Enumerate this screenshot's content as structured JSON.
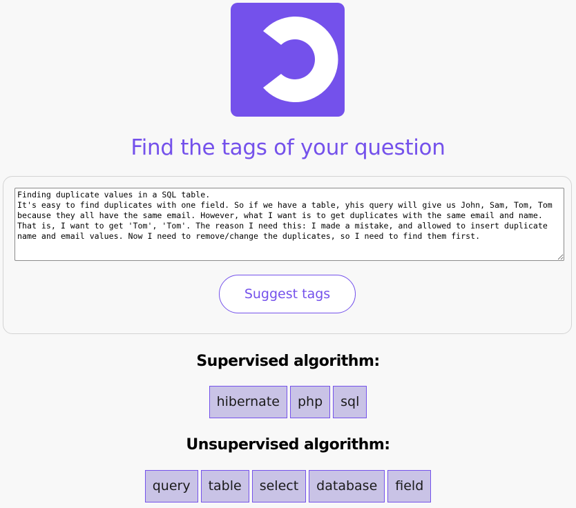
{
  "app": {
    "title": "Find the tags of your question",
    "brand_color": "#7451eb",
    "logo_icon": "half-ring-logo-icon"
  },
  "form": {
    "question_text": "Finding duplicate values in a SQL table.\nIt's easy to find duplicates with one field. So if we have a table, yhis query will give us John, Sam, Tom, Tom because they all have the same email. However, what I want is to get duplicates with the same email and name. That is, I want to get 'Tom', 'Tom'. The reason I need this: I made a mistake, and allowed to insert duplicate name and email values. Now I need to remove/change the duplicates, so I need to find them first.",
    "submit_label": "Suggest tags"
  },
  "results": {
    "supervised": {
      "heading": "Supervised algorithm:",
      "tags": [
        "hibernate",
        "php",
        "sql"
      ]
    },
    "unsupervised": {
      "heading": "Unsupervised algorithm:",
      "tags": [
        "query",
        "table",
        "select",
        "database",
        "field"
      ]
    },
    "tag_color": "#c9c3e6"
  }
}
